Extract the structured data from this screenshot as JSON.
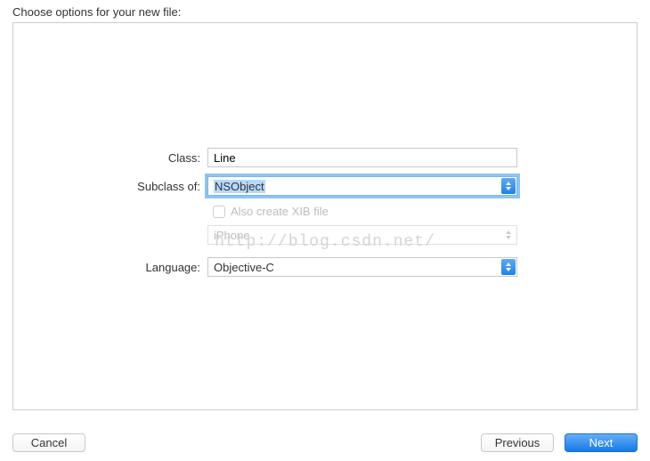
{
  "header": {
    "title": "Choose options for your new file:"
  },
  "form": {
    "class": {
      "label": "Class:",
      "value": "Line"
    },
    "subclass": {
      "label": "Subclass of:",
      "value": "NSObject"
    },
    "xib": {
      "label": "Also create XIB file"
    },
    "device": {
      "value": "iPhone"
    },
    "language": {
      "label": "Language:",
      "value": "Objective-C"
    }
  },
  "watermark": "http://blog.csdn.net/",
  "footer": {
    "cancel": "Cancel",
    "previous": "Previous",
    "next": "Next"
  }
}
